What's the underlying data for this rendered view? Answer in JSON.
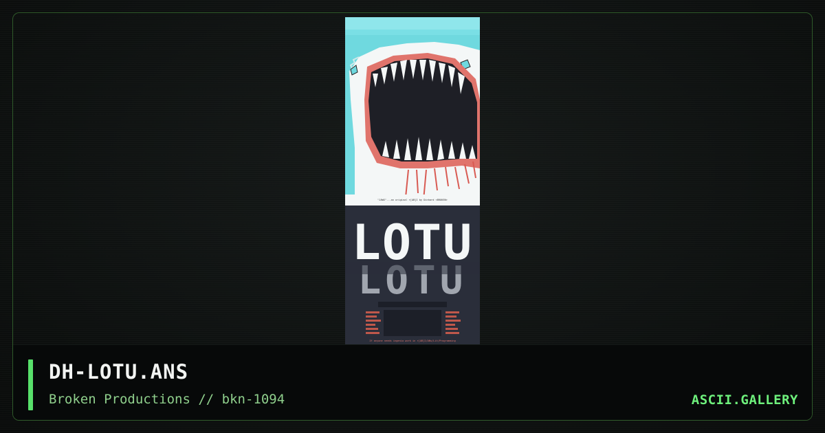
{
  "artwork": {
    "filename": "DH-LOTU.ANS",
    "credit": "Broken Productions // bkn-1094",
    "caption_text": "\"JAWS\"...an original r[AB]I by Dinhard <BROKEN>",
    "footer_text": "If anyone needs ingenia work in r[AB]I/ANs/Lit/Programming",
    "logo_text": "LOTU"
  },
  "site": {
    "brand": "ASCII.GALLERY"
  },
  "colors": {
    "accent": "#57e06a",
    "brand": "#6ef07c",
    "subtitle": "#8fcf8c",
    "frame_border": "#2f5a2a",
    "art_cyan": "#6fd9df",
    "art_red": "#e0746c"
  }
}
